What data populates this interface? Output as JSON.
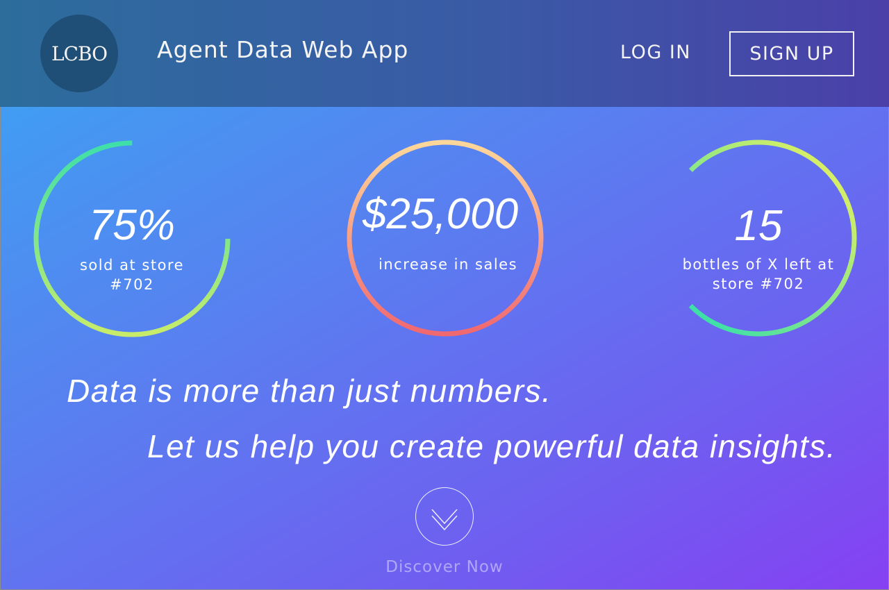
{
  "header": {
    "logo_text": "LCBO",
    "title": "Agent Data Web App",
    "login_label": "LOG IN",
    "signup_label": "SIGN UP"
  },
  "stats": [
    {
      "value": "75%",
      "label": "sold at store #702",
      "ring_fraction": 0.75,
      "gradient": [
        "#3ee0a8",
        "#c8ec6a"
      ]
    },
    {
      "value": "$25,000",
      "label": "increase in sales",
      "ring_fraction": 1.0,
      "gradient": [
        "#ffd79a",
        "#f06870"
      ]
    },
    {
      "value": "15",
      "label": "bottles of X left at store #702",
      "ring_fraction": 0.75,
      "gradient": [
        "#3ee0a8",
        "#d6ee66"
      ]
    }
  ],
  "taglines": {
    "line1": "Data is more than just numbers.",
    "line2": "Let us help you create powerful data insights."
  },
  "discover": {
    "icon": "chevron-down-icon",
    "label": "Discover Now"
  },
  "colors": {
    "header_start": "#2c6d9c",
    "header_end": "#4a40a8",
    "bg_start": "#3aa6f2",
    "bg_end": "#8640f2"
  }
}
